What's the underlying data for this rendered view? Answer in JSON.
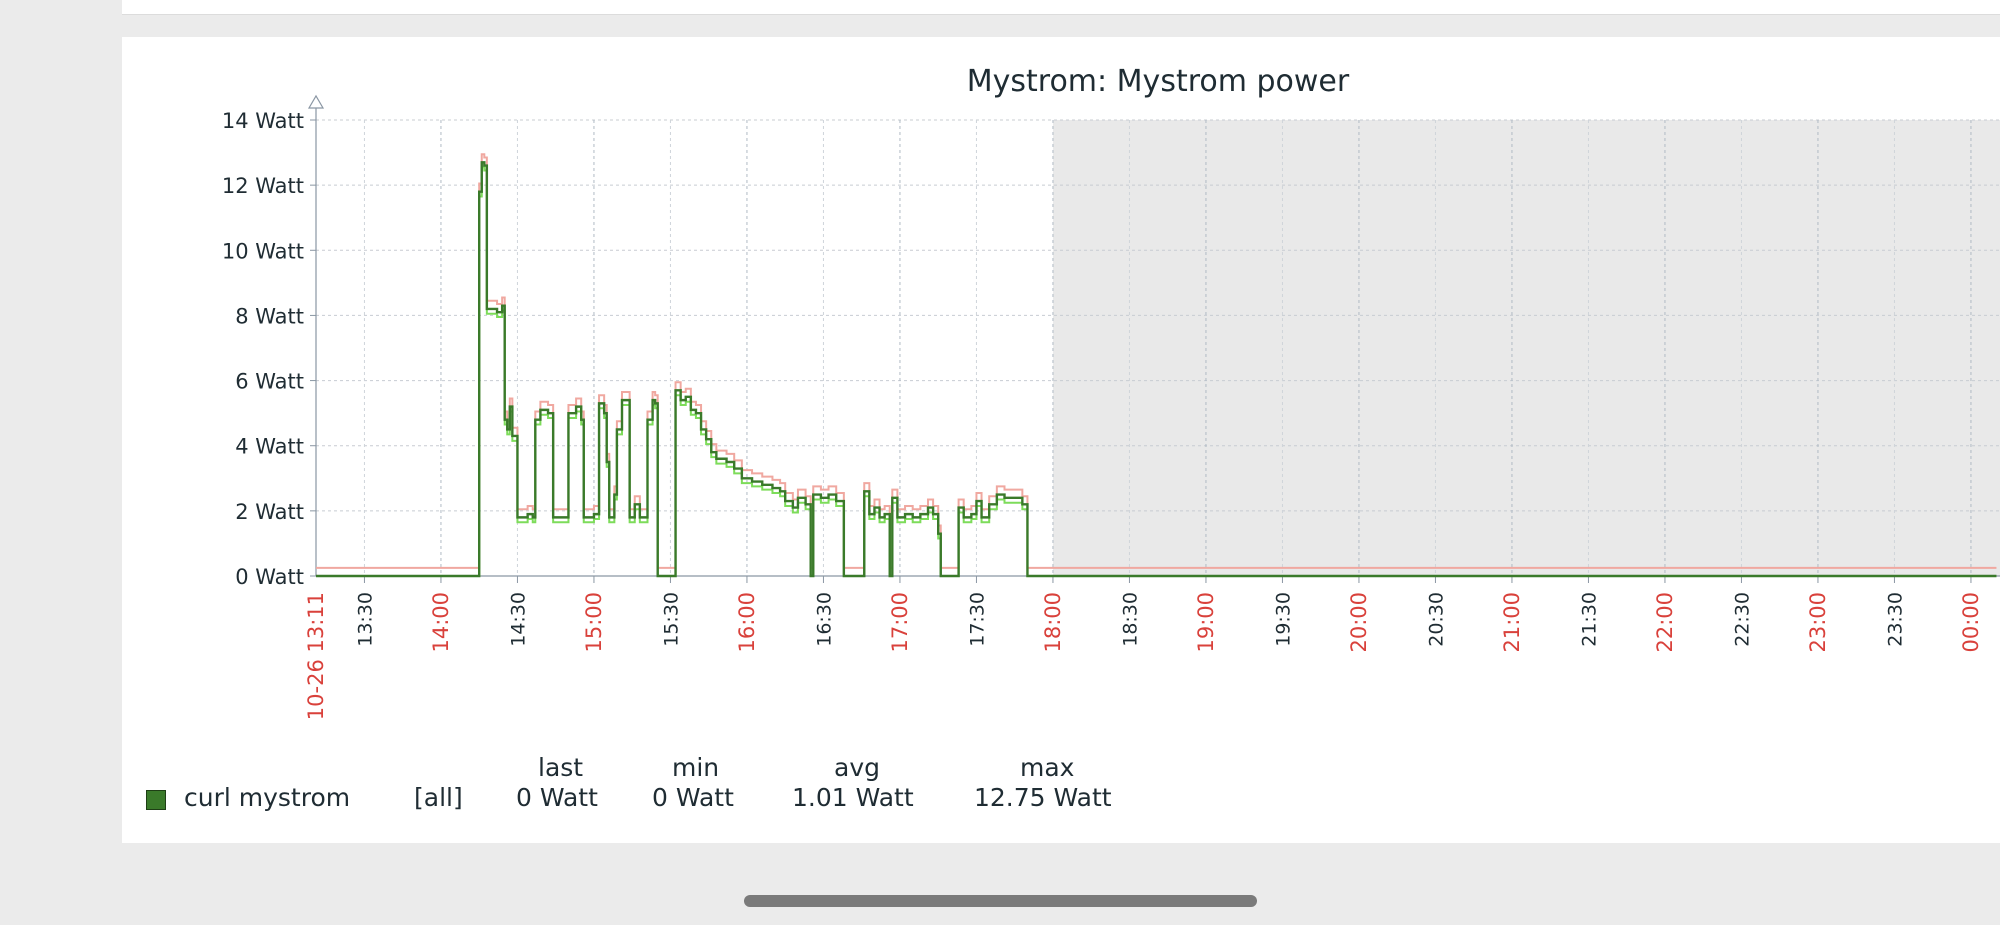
{
  "chart_data": {
    "type": "line",
    "title": "Mystrom: Mystrom power",
    "ylabel": "",
    "xlabel": "",
    "ylim": [
      0,
      14
    ],
    "y_unit": "Watt",
    "y_ticks": [
      "0 Watt",
      "2 Watt",
      "4 Watt",
      "6 Watt",
      "8 Watt",
      "10 Watt",
      "12 Watt",
      "14 Watt"
    ],
    "x_start_label": "10-26 13:11",
    "x_tick_labels": [
      "13:30",
      "14:00",
      "14:30",
      "15:00",
      "15:30",
      "16:00",
      "16:30",
      "17:00",
      "17:30",
      "18:00",
      "18:30",
      "19:00",
      "19:30",
      "20:00",
      "20:30",
      "21:00",
      "21:30",
      "22:00",
      "22:30",
      "23:00",
      "23:30",
      "00:00"
    ],
    "x_highlight_labels": [
      "14:00",
      "15:00",
      "16:00",
      "17:00",
      "18:00",
      "19:00",
      "20:00",
      "21:00",
      "22:00",
      "23:00",
      "00:00"
    ],
    "x_range": [
      "13:11",
      "00:10"
    ],
    "future_region_start": "18:00",
    "grid": true,
    "legend_position": "bottom-left",
    "series": [
      {
        "name": "curl mystrom",
        "color": "#3a7a2a",
        "min_color": "#7ddc5a",
        "max_color": "#f0a8a0",
        "points": [
          [
            "13:11",
            0
          ],
          [
            "14:14",
            0
          ],
          [
            "14:15",
            11.8
          ],
          [
            "14:16",
            12.7
          ],
          [
            "14:17",
            12.6
          ],
          [
            "14:18",
            8.2
          ],
          [
            "14:22",
            8.1
          ],
          [
            "14:24",
            8.3
          ],
          [
            "14:25",
            4.8
          ],
          [
            "14:26",
            4.5
          ],
          [
            "14:27",
            5.2
          ],
          [
            "14:28",
            4.3
          ],
          [
            "14:30",
            1.8
          ],
          [
            "14:34",
            1.9
          ],
          [
            "14:36",
            1.8
          ],
          [
            "14:37",
            4.8
          ],
          [
            "14:39",
            5.1
          ],
          [
            "14:42",
            5.0
          ],
          [
            "14:44",
            1.8
          ],
          [
            "14:49",
            1.8
          ],
          [
            "14:50",
            5.0
          ],
          [
            "14:53",
            5.2
          ],
          [
            "14:55",
            4.8
          ],
          [
            "14:56",
            1.8
          ],
          [
            "15:00",
            1.9
          ],
          [
            "15:02",
            5.3
          ],
          [
            "15:04",
            5.0
          ],
          [
            "15:05",
            3.5
          ],
          [
            "15:06",
            1.8
          ],
          [
            "15:08",
            2.5
          ],
          [
            "15:09",
            4.5
          ],
          [
            "15:11",
            5.4
          ],
          [
            "15:13",
            5.4
          ],
          [
            "15:14",
            1.8
          ],
          [
            "15:16",
            2.2
          ],
          [
            "15:18",
            1.8
          ],
          [
            "15:20",
            1.8
          ],
          [
            "15:21",
            4.8
          ],
          [
            "15:23",
            5.4
          ],
          [
            "15:24",
            5.3
          ],
          [
            "15:25",
            0
          ],
          [
            "15:31",
            0
          ],
          [
            "15:32",
            5.7
          ],
          [
            "15:34",
            5.4
          ],
          [
            "15:36",
            5.5
          ],
          [
            "15:38",
            5.1
          ],
          [
            "15:40",
            5.0
          ],
          [
            "15:42",
            4.5
          ],
          [
            "15:44",
            4.2
          ],
          [
            "15:46",
            3.8
          ],
          [
            "15:48",
            3.6
          ],
          [
            "15:52",
            3.5
          ],
          [
            "15:55",
            3.3
          ],
          [
            "15:58",
            3.0
          ],
          [
            "16:02",
            2.9
          ],
          [
            "16:06",
            2.8
          ],
          [
            "16:10",
            2.7
          ],
          [
            "16:13",
            2.6
          ],
          [
            "16:15",
            2.3
          ],
          [
            "16:18",
            2.1
          ],
          [
            "16:20",
            2.4
          ],
          [
            "16:23",
            2.2
          ],
          [
            "16:25",
            0
          ],
          [
            "16:26",
            2.5
          ],
          [
            "16:29",
            2.4
          ],
          [
            "16:32",
            2.5
          ],
          [
            "16:35",
            2.3
          ],
          [
            "16:38",
            0
          ],
          [
            "16:45",
            0
          ],
          [
            "16:46",
            2.6
          ],
          [
            "16:48",
            1.9
          ],
          [
            "16:50",
            2.1
          ],
          [
            "16:52",
            1.8
          ],
          [
            "16:54",
            1.9
          ],
          [
            "16:56",
            0
          ],
          [
            "16:57",
            2.4
          ],
          [
            "16:59",
            1.8
          ],
          [
            "17:02",
            1.9
          ],
          [
            "17:05",
            1.8
          ],
          [
            "17:08",
            1.9
          ],
          [
            "17:11",
            2.1
          ],
          [
            "17:13",
            1.9
          ],
          [
            "17:15",
            1.3
          ],
          [
            "17:16",
            0
          ],
          [
            "17:22",
            0
          ],
          [
            "17:23",
            2.1
          ],
          [
            "17:25",
            1.8
          ],
          [
            "17:28",
            1.9
          ],
          [
            "17:30",
            2.3
          ],
          [
            "17:32",
            1.8
          ],
          [
            "17:35",
            2.2
          ],
          [
            "17:38",
            2.5
          ],
          [
            "17:41",
            2.4
          ],
          [
            "17:45",
            2.4
          ],
          [
            "17:48",
            2.2
          ],
          [
            "17:50",
            0
          ],
          [
            "17:51",
            0
          ],
          [
            "00:10",
            0
          ]
        ]
      }
    ]
  },
  "legend": {
    "series_name": "curl mystrom",
    "function": "[all]",
    "headers": {
      "last": "last",
      "min": "min",
      "avg": "avg",
      "max": "max"
    },
    "values": {
      "last": "0 Watt",
      "min": "0 Watt",
      "avg": "1.01 Watt",
      "max": "12.75 Watt"
    }
  }
}
